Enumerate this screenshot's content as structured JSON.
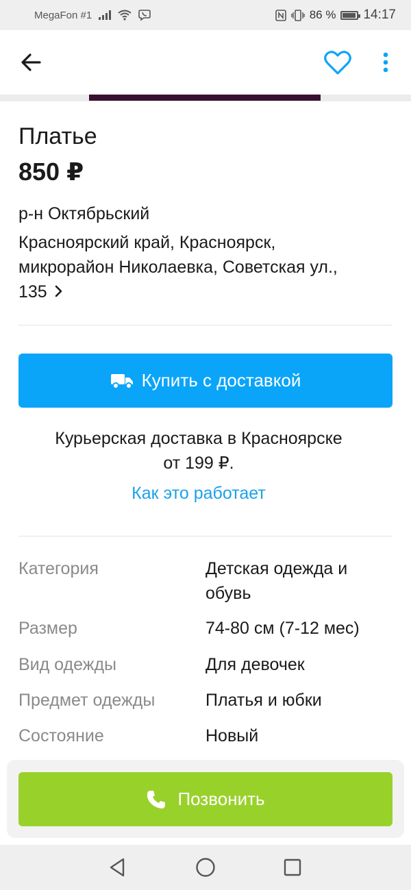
{
  "status_bar": {
    "carrier": "MegaFon #1",
    "battery": "86 %",
    "time": "14:17"
  },
  "icons": {
    "back": "arrow-left-icon",
    "favorite": "heart-icon",
    "more": "more-vertical-icon",
    "delivery": "truck-icon",
    "call": "phone-icon",
    "address_chevron": "chevron-right-icon",
    "nav_back": "triangle-back-icon",
    "nav_home": "circle-home-icon",
    "nav_recents": "square-recents-icon"
  },
  "colors": {
    "accent_blue": "#0aa5f8",
    "link_blue": "#1aa2ea",
    "call_green": "#99d12b"
  },
  "listing": {
    "title": "Платье",
    "price": "850 ₽",
    "district": "р-н Октябрьский",
    "address_line1": "Красноярский край, Красноярск,",
    "address_line2": "микрорайон Николаевка, Советская ул.,",
    "address_line3": "135"
  },
  "delivery": {
    "buy_label": "Купить с доставкой",
    "info_line1": "Курьерская доставка в Красноярске",
    "info_line2": "от 199 ₽.",
    "how_link": "Как это работает"
  },
  "specs": [
    {
      "label": "Категория",
      "value_line1": "Детская одежда и",
      "value_line2": "обувь"
    },
    {
      "label": "Размер",
      "value": "74-80 см (7-12 мес)"
    },
    {
      "label": "Вид одежды",
      "value": "Для девочек"
    },
    {
      "label": "Предмет одежды",
      "value": "Платья и юбки"
    },
    {
      "label": "Состояние",
      "value": "Новый"
    }
  ],
  "call": {
    "label": "Позвонить"
  }
}
